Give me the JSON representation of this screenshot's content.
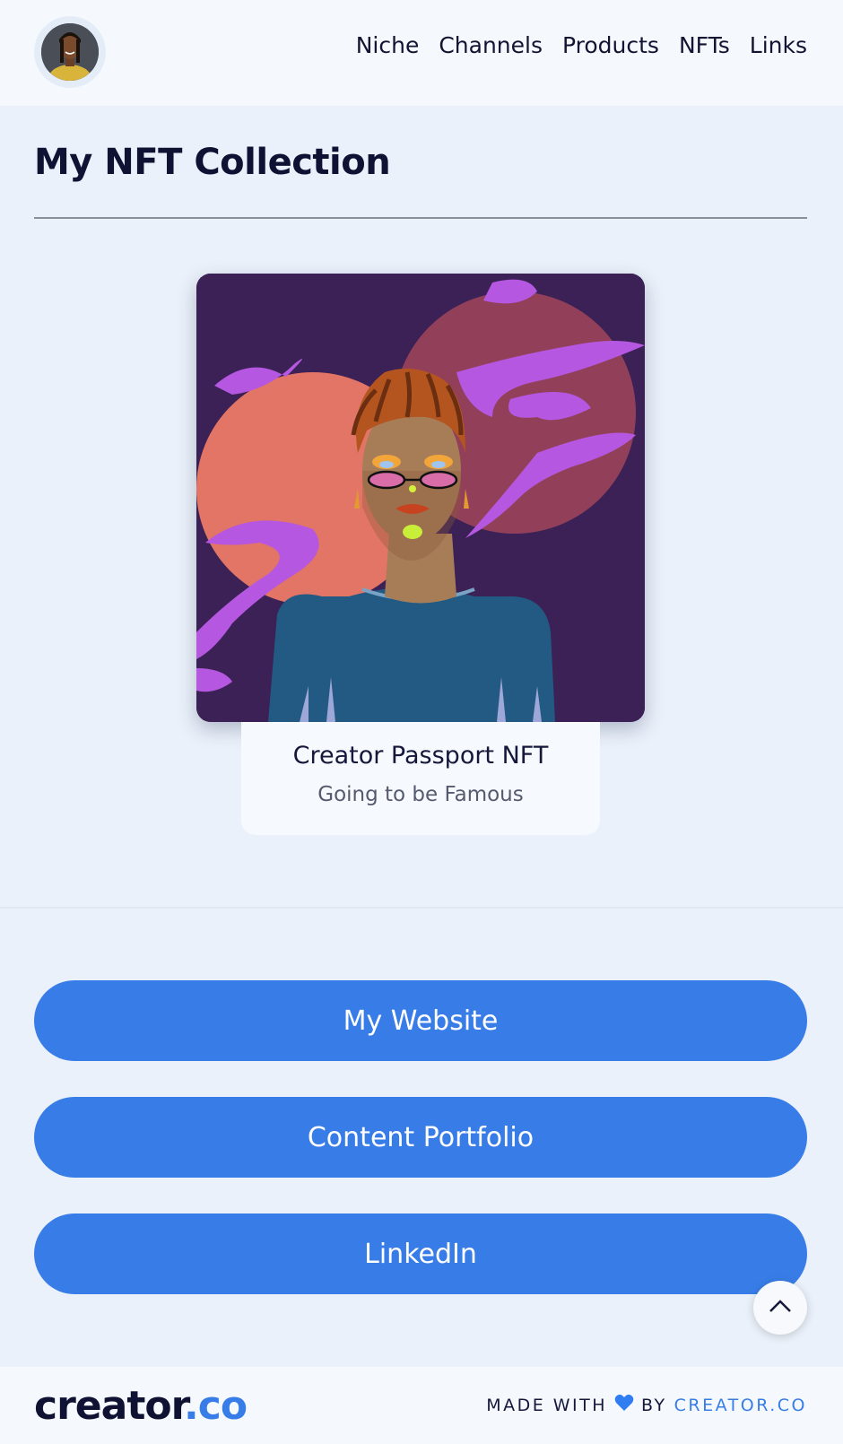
{
  "header": {
    "nav": [
      "Niche",
      "Channels",
      "Products",
      "NFTs",
      "Links"
    ]
  },
  "nft_section": {
    "title": "My NFT Collection",
    "items": [
      {
        "name": "Creator Passport NFT",
        "description": "Going to be Famous"
      }
    ]
  },
  "links": [
    "My Website",
    "Content Portfolio",
    "LinkedIn"
  ],
  "footer": {
    "logo_main": "creator",
    "logo_ext": ".co",
    "made_with": "MADE WITH",
    "by": "BY",
    "brand": "CREATOR.CO",
    "heart_icon": "blue-heart-icon"
  },
  "colors": {
    "accent": "#387de7",
    "page_bg": "#eaf1fa",
    "header_bg": "#f5f9fd",
    "text": "#0f1233"
  }
}
